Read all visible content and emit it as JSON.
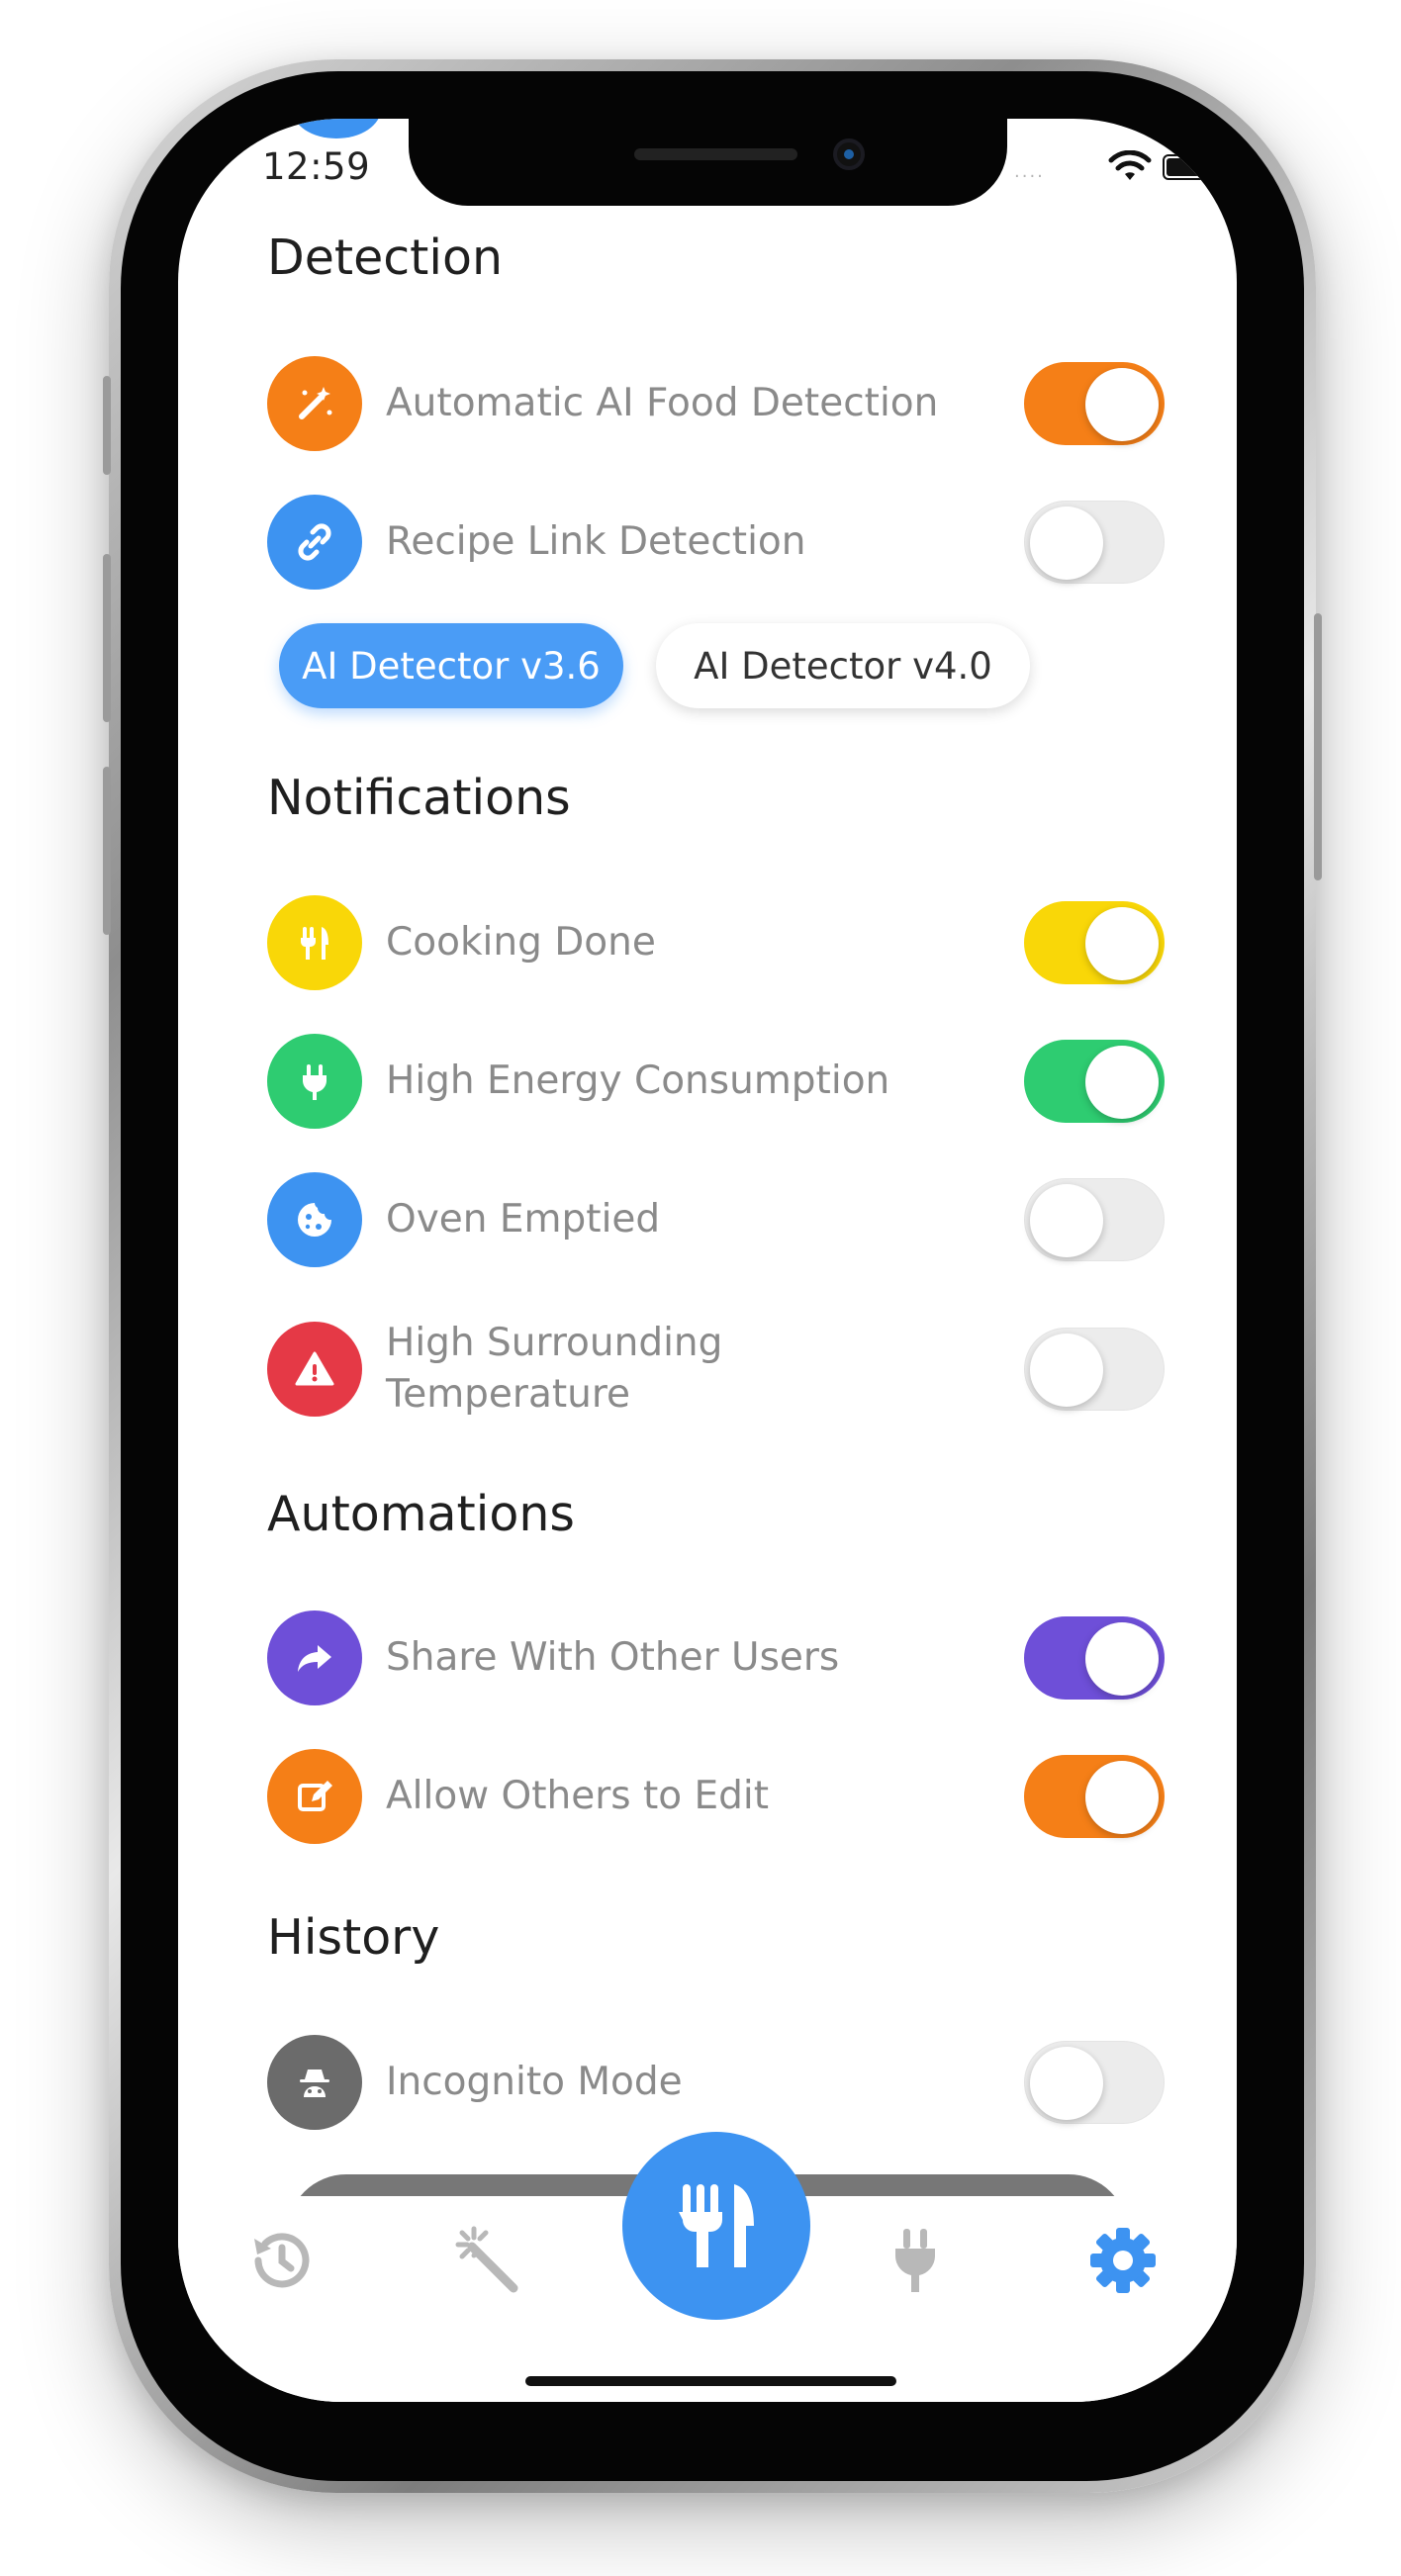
{
  "status_bar": {
    "time": "12:59"
  },
  "accent_color": "#3d93f1",
  "sections": {
    "detection": {
      "title": "Detection",
      "items": [
        {
          "label": "Automatic AI Food Detection",
          "icon": "magic-wand-icon",
          "icon_color": "#f57f17",
          "toggle_on": true,
          "toggle_color": "#f57f17"
        },
        {
          "label": "Recipe Link Detection",
          "icon": "link-icon",
          "icon_color": "#3d93f1",
          "toggle_on": false
        }
      ],
      "detector_options": [
        {
          "label": "AI Detector v3.6",
          "selected": true
        },
        {
          "label": "AI Detector v4.0",
          "selected": false
        }
      ]
    },
    "notifications": {
      "title": "Notifications",
      "items": [
        {
          "label": "Cooking Done",
          "icon": "utensils-icon",
          "icon_color": "#f9d708",
          "toggle_on": true,
          "toggle_color": "#f9d708"
        },
        {
          "label": "High Energy Consumption",
          "icon": "plug-icon",
          "icon_color": "#2ecc71",
          "toggle_on": true,
          "toggle_color": "#2ecc71"
        },
        {
          "label": "Oven Emptied",
          "icon": "cookie-icon",
          "icon_color": "#3d93f1",
          "toggle_on": false
        },
        {
          "label_line1": "High Surrounding",
          "label_line2": "Temperature",
          "icon": "warning-icon",
          "icon_color": "#e53946",
          "toggle_on": false
        }
      ]
    },
    "automations": {
      "title": "Automations",
      "items": [
        {
          "label": "Share With Other Users",
          "icon": "share-icon",
          "icon_color": "#6e4fd8",
          "toggle_on": true,
          "toggle_color": "#6e4fd8"
        },
        {
          "label": "Allow Others to Edit",
          "icon": "edit-icon",
          "icon_color": "#f57f17",
          "toggle_on": true,
          "toggle_color": "#f57f17"
        }
      ]
    },
    "history": {
      "title": "History",
      "items": [
        {
          "label": "Incognito Mode",
          "icon": "incognito-icon",
          "icon_color": "#6b6b6b",
          "toggle_on": false
        }
      ]
    }
  },
  "tab_bar": {
    "tabs": [
      {
        "icon": "history-icon",
        "active": false
      },
      {
        "icon": "magic-wand-icon",
        "active": false
      },
      {
        "icon": "utensils-icon",
        "active": true,
        "center": true
      },
      {
        "icon": "plug-icon",
        "active": false
      },
      {
        "icon": "gear-icon",
        "active": true
      }
    ]
  }
}
